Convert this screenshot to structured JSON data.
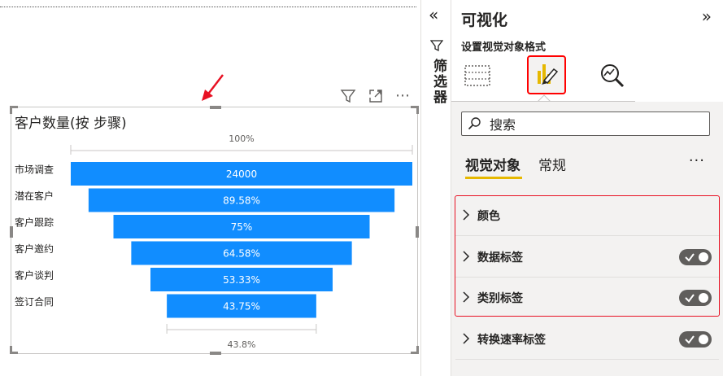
{
  "visual": {
    "title": "客户数量(按 步骤)",
    "header_icons": [
      "filter-icon",
      "focus-mode-icon",
      "more-options-icon"
    ],
    "more_label": "⋯"
  },
  "chart_data": {
    "type": "funnel",
    "title": "客户数量(按 步骤)",
    "categories": [
      "市场调查",
      "潜在客户",
      "客户跟踪",
      "客户邀约",
      "客户谈判",
      "签订合同"
    ],
    "relative_percent": [
      100,
      89.58,
      75,
      64.58,
      53.33,
      43.75
    ],
    "data_labels": [
      "24000",
      "89.58%",
      "75%",
      "64.58%",
      "53.33%",
      "43.75%"
    ],
    "top_conversion_label": "100%",
    "bottom_conversion_label": "43.8%",
    "bar_color": "#118dff"
  },
  "filters": {
    "collapse_glyph": "«",
    "label": "筛选器"
  },
  "viz_pane": {
    "title": "可视化",
    "expand_glyph": "»",
    "subtitle": "设置视觉对象格式",
    "tabs": [
      "fields-icon",
      "format-paintbrush-icon",
      "analytics-icon"
    ],
    "active_tab": "format-paintbrush-icon",
    "search_placeholder": "搜索",
    "subtabs": [
      "视觉对象",
      "常规"
    ],
    "more_label": "···",
    "sections": [
      {
        "label": "颜色",
        "toggle": null
      },
      {
        "label": "数据标签",
        "toggle": "on"
      },
      {
        "label": "类别标签",
        "toggle": "on"
      },
      {
        "label": "转换速率标签",
        "toggle": "on"
      }
    ]
  },
  "colors": {
    "accent_bar": "#118dff",
    "highlight_red": "#e81123",
    "subtab_underline": "#e6b800",
    "pane_background": "#f3f2f1"
  }
}
